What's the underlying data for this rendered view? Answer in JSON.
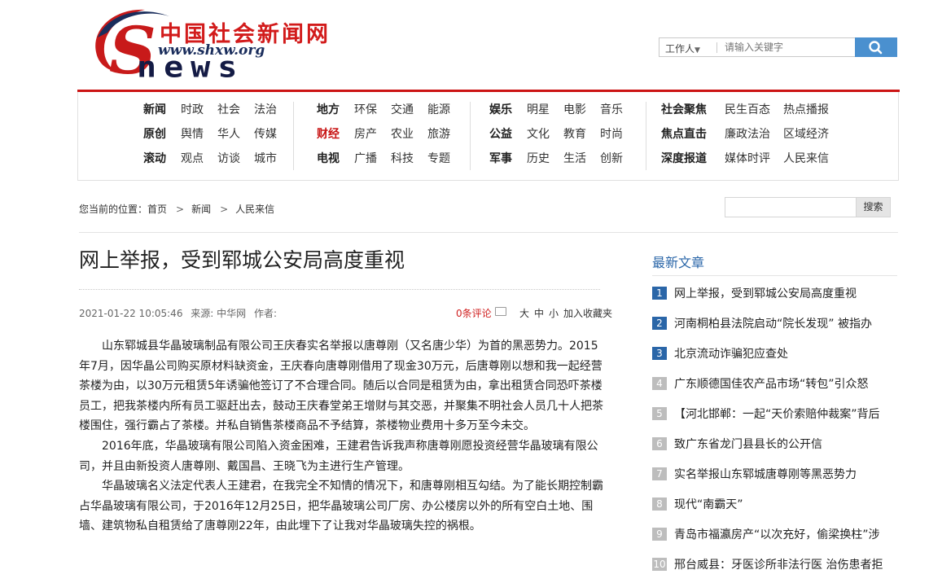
{
  "logo": {
    "chinese": "中国社会新闻网",
    "url": "www.shxw.org",
    "news": "news"
  },
  "search": {
    "scope": "工作人",
    "placeholder": "请输入关键字",
    "button_icon": "search-icon"
  },
  "nav": {
    "columns": [
      {
        "rows": [
          [
            "新闻",
            "时政",
            "社会",
            "法治"
          ],
          [
            "原创",
            "舆情",
            "华人",
            "传媒"
          ],
          [
            "滚动",
            "观点",
            "访谈",
            "城市"
          ]
        ]
      },
      {
        "rows": [
          [
            "地方",
            "环保",
            "交通",
            "能源"
          ],
          [
            "财经",
            "房产",
            "农业",
            "旅游"
          ],
          [
            "电视",
            "广播",
            "科技",
            "专题"
          ]
        ]
      },
      {
        "rows": [
          [
            "娱乐",
            "明星",
            "电影",
            "音乐"
          ],
          [
            "公益",
            "文化",
            "教育",
            "时尚"
          ],
          [
            "军事",
            "历史",
            "生活",
            "创新"
          ]
        ]
      },
      {
        "rows": [
          [
            "社会聚焦",
            "民生百态",
            "热点播报"
          ],
          [
            "焦点直击",
            "廉政法治",
            "区域经济"
          ],
          [
            "深度报道",
            "媒体时评",
            "人民来信"
          ]
        ]
      }
    ],
    "highlight_color": "#c81414"
  },
  "breadcrumb": {
    "prefix": "您当前的位置：",
    "items": [
      "首页",
      "新闻",
      "人民来信"
    ],
    "separator": ">"
  },
  "side_search": {
    "button": "搜索"
  },
  "article": {
    "title": "网上举报，受到郓城公安局高度重视",
    "date": "2021-01-22 10:05:46",
    "source": "来源: 中华网",
    "author": "作者:",
    "comment": "0条评论",
    "font_large": "大",
    "font_medium": "中",
    "font_small": "小",
    "bookmark": "加入收藏夹",
    "paragraphs": [
      "山东郓城县华晶玻璃制品有限公司王庆春实名举报以唐尊刚（又名唐少华）为首的黑恶势力。2015年7月，因华晶公司购买原材料缺资金，王庆春向唐尊刚借用了现金30万元，后唐尊刚以想和我一起经营茶楼为由，以30万元租赁5年诱骗他签订了不合理合同。随后以合同是租赁为由，拿出租赁合同恐吓茶楼员工，把我茶楼内所有员工驱赶出去，鼓动王庆春堂弟王增财与其交恶，并聚集不明社会人员几十人把茶楼围住，强行霸占了茶楼。并私自销售茶楼商品不予结算，茶楼物业费用十多万至今未交。",
      "2016年底，华晶玻璃有限公司陷入资金困难，王建君告诉我声称唐尊刚愿投资经营华晶玻璃有限公司，并且由新投资人唐尊刚、戴国昌、王晓飞为主进行生产管理。",
      "华晶玻璃名义法定代表人王建君，在我完全不知情的情况下，和唐尊刚相互勾结。为了能长期控制霸占华晶玻璃有限公司，于2016年12月25日，把华晶玻璃公司厂房、办公楼房以外的所有空白土地、围墙、建筑物私自租赁给了唐尊刚22年，由此埋下了让我对华晶玻璃失控的祸根。"
    ]
  },
  "sidebar": {
    "title": "最新文章",
    "items": [
      {
        "num": "1",
        "text": "网上举报，受到郓城公安局高度重视"
      },
      {
        "num": "2",
        "text": "河南桐柏县法院启动“院长发现” 被指办"
      },
      {
        "num": "3",
        "text": "北京流动诈骗犯应查处"
      },
      {
        "num": "4",
        "text": "广东顺德国佳农产品市场“转包”引众怒"
      },
      {
        "num": "5",
        "text": "【河北邯郸：一起“天价索赔仲裁案”背后"
      },
      {
        "num": "6",
        "text": "致广东省龙门县县长的公开信"
      },
      {
        "num": "7",
        "text": "实名举报山东郓城唐尊刚等黑恶势力"
      },
      {
        "num": "8",
        "text": "现代“南霸天”"
      },
      {
        "num": "9",
        "text": "青岛市福瀛房产“以次充好，偷梁换柱”涉"
      },
      {
        "num": "10",
        "text": "邢台威县：牙医诊所非法行医 治伤患者拒"
      }
    ],
    "accent_color": "#2a66a8"
  }
}
